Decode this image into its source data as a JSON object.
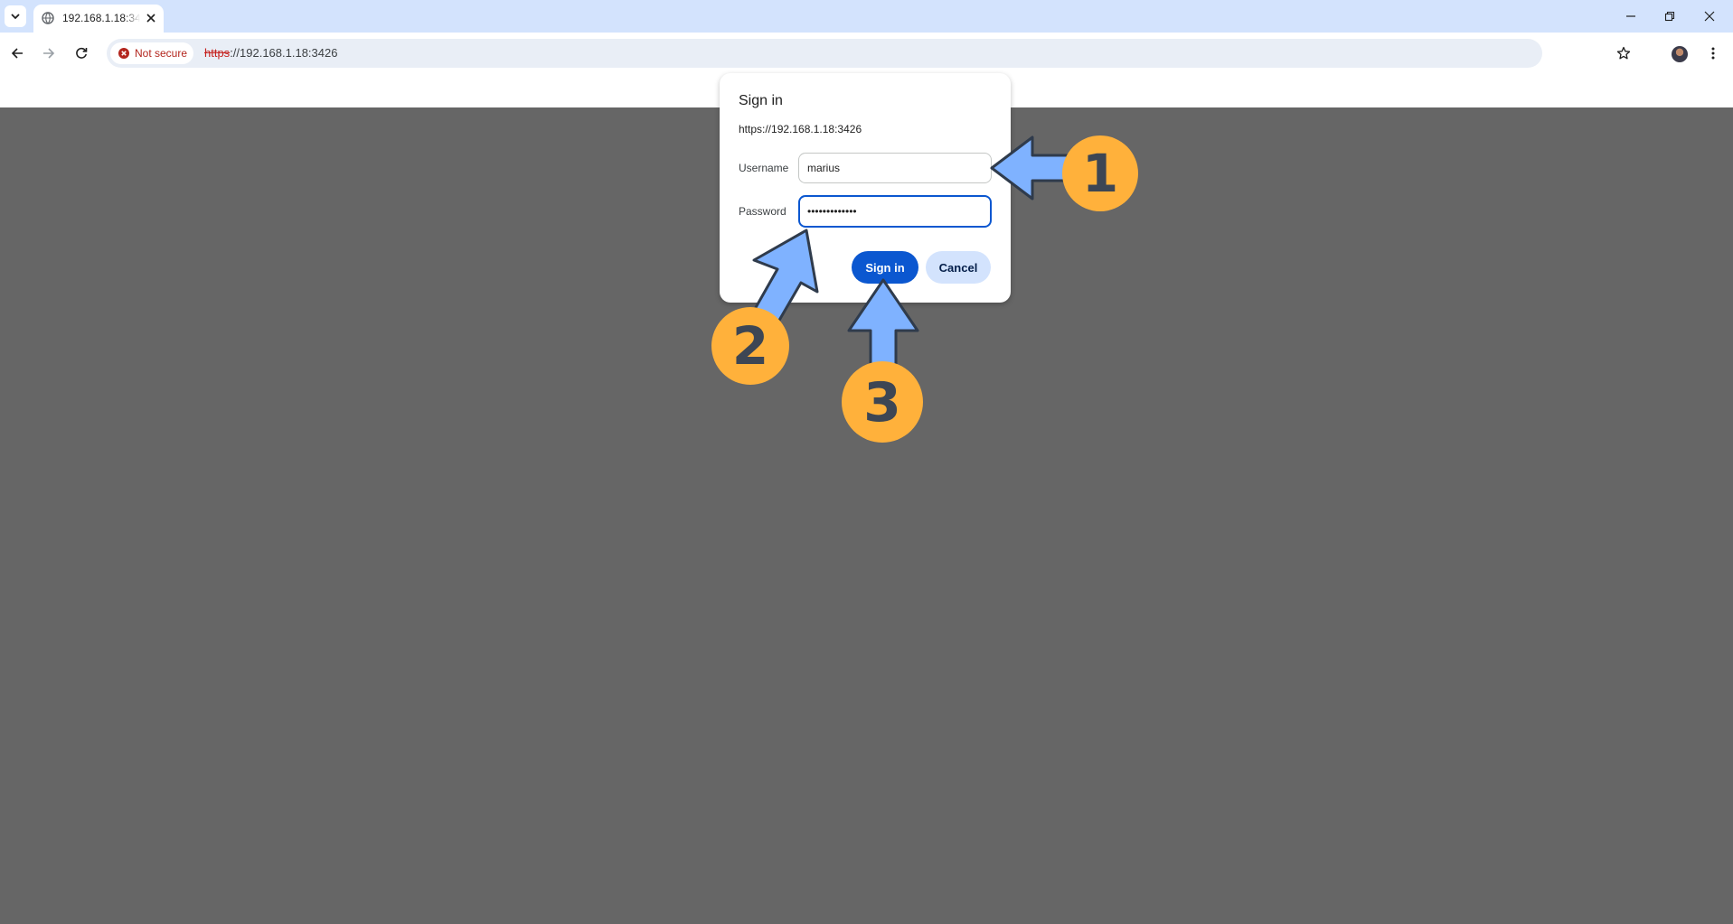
{
  "browser": {
    "tab": {
      "title": "192.168.1.18:3426"
    },
    "address_bar": {
      "security_label": "Not secure",
      "url_scheme": "https",
      "url_rest": "://192.168.1.18:3426"
    }
  },
  "dialog": {
    "title": "Sign in",
    "origin": "https://192.168.1.18:3426",
    "username_label": "Username",
    "username_value": "marius",
    "password_label": "Password",
    "password_value": "•••••••••••••",
    "sign_in_label": "Sign in",
    "cancel_label": "Cancel"
  },
  "callouts": [
    {
      "number": "1"
    },
    {
      "number": "2"
    },
    {
      "number": "3"
    }
  ],
  "colors": {
    "accent": "#0b57d0",
    "overlay": "#666666",
    "callout_badge": "#ffb13b",
    "callout_arrow": "#7fb2ff",
    "not_secure": "#b3261e"
  }
}
